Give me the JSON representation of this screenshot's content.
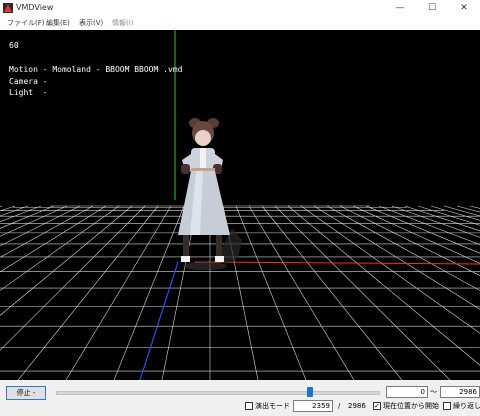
{
  "window": {
    "title": "VMDView",
    "minimize": "—",
    "maximize": "☐",
    "close": "✕"
  },
  "menu": [
    "ファイル(F)",
    "編集(E)",
    "表示(V)",
    "情報(I)"
  ],
  "overlay": {
    "fps": "60",
    "motion": "Motion - Momoland - BBOOM BBOOM .vmd",
    "camera": "Camera -",
    "light": "Light  -"
  },
  "controls": {
    "stop_label": "停止 -",
    "seek": {
      "value": 2359,
      "max": 2986
    },
    "range_start": "0",
    "range_sep": "〜",
    "range_end": "2986",
    "demo_mode_label": "演出モード",
    "demo_mode_checked": false,
    "frame_value": "2359",
    "frame_sep": "/",
    "frame_total": "2986",
    "from_current_label": "現在位置から開始",
    "from_current_checked": true,
    "loop_label": "繰り返し",
    "loop_checked": false
  },
  "colors": {
    "viewport_bg": "#000000",
    "grid": "#d9d9d9",
    "x_axis": "#ff2a2a",
    "y_axis": "#27d427",
    "z_axis": "#2a4dff",
    "accent": "#1a73d6"
  }
}
